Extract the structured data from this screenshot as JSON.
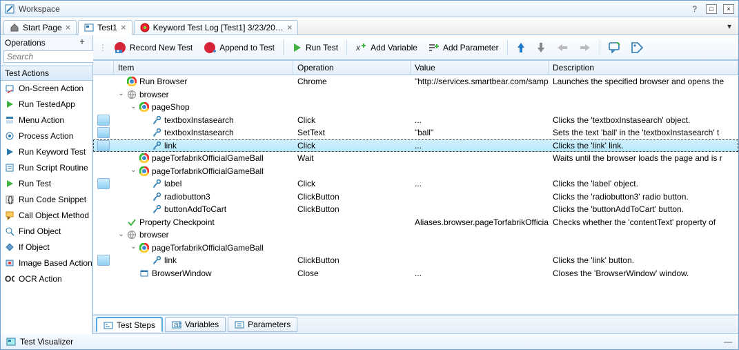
{
  "window": {
    "title": "Workspace",
    "help_tooltip": "?",
    "close": "×"
  },
  "tabs": [
    {
      "label": "Start Page"
    },
    {
      "label": "Test1"
    },
    {
      "label": "Keyword Test Log [Test1] 3/23/20…"
    }
  ],
  "left": {
    "title": "Operations",
    "search_placeholder": "Search",
    "category": "Test Actions",
    "items": [
      "On-Screen Action",
      "Run TestedApp",
      "Menu Action",
      "Process Action",
      "Run Keyword Test",
      "Run Script Routine",
      "Run Test",
      "Run Code Snippet",
      "Call Object Method",
      "Find Object",
      "If Object",
      "Image Based Action",
      "OCR Action"
    ]
  },
  "toolbar": {
    "record": "Record New Test",
    "append": "Append to Test",
    "run": "Run Test",
    "addvar": "Add Variable",
    "addparam": "Add Parameter"
  },
  "grid": {
    "cols": {
      "item": "Item",
      "op": "Operation",
      "val": "Value",
      "desc": "Description"
    },
    "rows": [
      {
        "indent": 0,
        "item": "Run Browser",
        "op": "Chrome",
        "val": "\"http://services.smartbear.com/sampl",
        "desc": "Launches the specified browser and opens the"
      },
      {
        "indent": 0,
        "item": "browser",
        "exp": "v"
      },
      {
        "indent": 1,
        "item": "pageShop",
        "exp": "v"
      },
      {
        "indent": 2,
        "item": "textboxInstasearch",
        "op": "Click",
        "val": "...",
        "desc": "Clicks the 'textboxInstasearch' object.",
        "thumb": true
      },
      {
        "indent": 2,
        "item": "textboxInstasearch",
        "op": "SetText",
        "val": "\"ball\"",
        "desc": "Sets the text 'ball' in the 'textboxInstasearch' t",
        "thumb": true
      },
      {
        "indent": 2,
        "item": "link",
        "op": "Click",
        "val": "...",
        "desc": "Clicks the 'link' link.",
        "thumb": true,
        "sel": true
      },
      {
        "indent": 1,
        "item": "pageTorfabrikOfficialGameBall",
        "op": "Wait",
        "desc": "Waits until the browser loads the page and is r"
      },
      {
        "indent": 1,
        "item": "pageTorfabrikOfficialGameBall",
        "exp": "v"
      },
      {
        "indent": 2,
        "item": "label",
        "op": "Click",
        "val": "...",
        "desc": "Clicks the 'label' object.",
        "thumb": true
      },
      {
        "indent": 2,
        "item": "radiobutton3",
        "op": "ClickButton",
        "desc": "Clicks the 'radiobutton3' radio button."
      },
      {
        "indent": 2,
        "item": "buttonAddToCart",
        "op": "ClickButton",
        "desc": "Clicks the 'buttonAddToCart' button."
      },
      {
        "indent": 0,
        "item": "Property Checkpoint",
        "val": "Aliases.browser.pageTorfabrikOfficial",
        "desc": "Checks whether the 'contentText' property of"
      },
      {
        "indent": 0,
        "item": "browser",
        "exp": "v"
      },
      {
        "indent": 1,
        "item": "pageTorfabrikOfficialGameBall",
        "exp": "v"
      },
      {
        "indent": 2,
        "item": "link",
        "op": "ClickButton",
        "desc": "Clicks the 'link' button.",
        "thumb": true
      },
      {
        "indent": 1,
        "item": "BrowserWindow",
        "op": "Close",
        "val": "...",
        "desc": "Closes the 'BrowserWindow' window."
      }
    ]
  },
  "bot_tabs": {
    "steps": "Test Steps",
    "vars": "Variables",
    "params": "Parameters"
  },
  "visualizer": {
    "title": "Test Visualizer"
  }
}
